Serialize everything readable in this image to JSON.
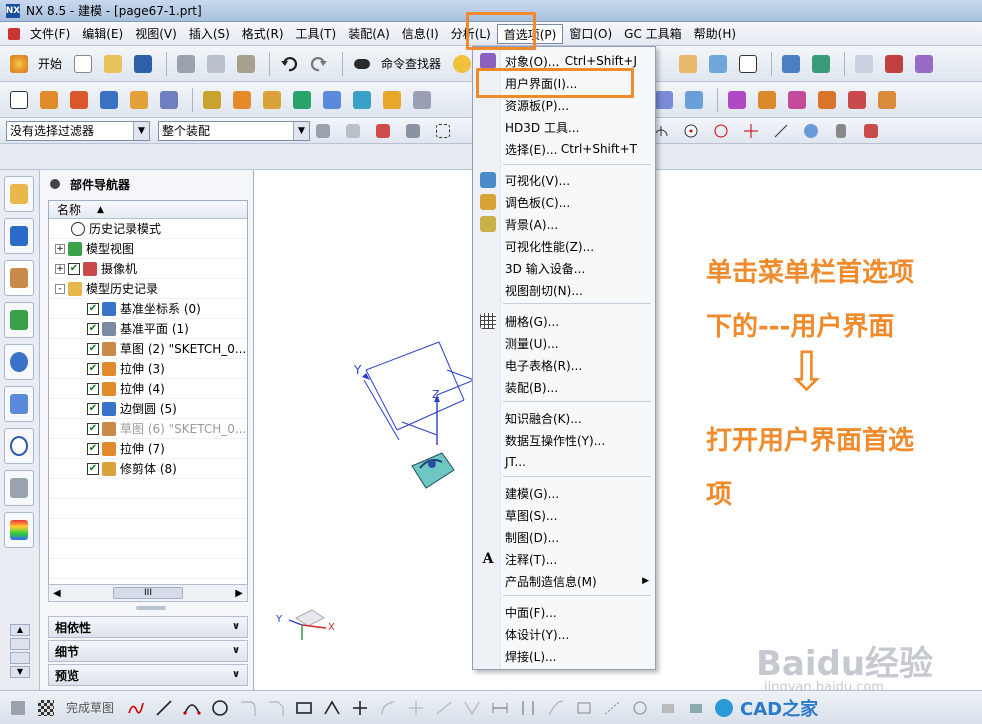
{
  "titlebar": {
    "logo": "NX",
    "title": "NX 8.5 - 建模 - [page67-1.prt]"
  },
  "menubar": {
    "items": [
      "文件(F)",
      "编辑(E)",
      "视图(V)",
      "插入(S)",
      "格式(R)",
      "工具(T)",
      "装配(A)",
      "信息(I)",
      "分析(L)",
      "首选项(P)",
      "窗口(O)",
      "GC 工具箱",
      "帮助(H)"
    ],
    "active_index": 9
  },
  "toolbar": {
    "start_label": "开始",
    "command_finder_label": "命令查找器",
    "filter_select": "没有选择过滤器",
    "scope_select": "整个装配"
  },
  "navigator": {
    "title": "部件导航器",
    "column_header": "名称",
    "rows": [
      {
        "label": "历史记录模式",
        "checked": null,
        "expander": null,
        "dim": false,
        "indent": 1
      },
      {
        "label": "模型视图",
        "checked": null,
        "expander": "+",
        "dim": false,
        "indent": 0
      },
      {
        "label": "摄像机",
        "checked": true,
        "expander": "+",
        "dim": false,
        "indent": 0
      },
      {
        "label": "模型历史记录",
        "checked": null,
        "expander": "-",
        "dim": false,
        "indent": 0
      },
      {
        "label": "基准坐标系 (0)",
        "checked": true,
        "expander": null,
        "dim": false,
        "indent": 2
      },
      {
        "label": "基准平面 (1)",
        "checked": true,
        "expander": null,
        "dim": false,
        "indent": 2
      },
      {
        "label": "草图 (2) \"SKETCH_0...",
        "checked": true,
        "expander": null,
        "dim": false,
        "indent": 2
      },
      {
        "label": "拉伸 (3)",
        "checked": true,
        "expander": null,
        "dim": false,
        "indent": 2
      },
      {
        "label": "拉伸 (4)",
        "checked": true,
        "expander": null,
        "dim": false,
        "indent": 2
      },
      {
        "label": "边倒圆 (5)",
        "checked": true,
        "expander": null,
        "dim": false,
        "indent": 2
      },
      {
        "label": "草图 (6) \"SKETCH_0...",
        "checked": true,
        "expander": null,
        "dim": true,
        "indent": 2
      },
      {
        "label": "拉伸 (7)",
        "checked": true,
        "expander": null,
        "dim": false,
        "indent": 2
      },
      {
        "label": "修剪体 (8)",
        "checked": true,
        "expander": null,
        "dim": false,
        "indent": 2
      }
    ],
    "scroll_thumb": "III",
    "sections": [
      "相依性",
      "细节",
      "预览"
    ]
  },
  "dropdown": {
    "items": [
      {
        "label": "对象(O)...",
        "shortcut": "Ctrl+Shift+J",
        "icon": "brush-icon",
        "color": "#8a5fbf"
      },
      {
        "label": "用户界面(I)...",
        "shortcut": "",
        "icon": "",
        "color": ""
      },
      {
        "label": "资源板(P)...",
        "shortcut": "",
        "icon": "",
        "color": ""
      },
      {
        "label": "HD3D 工具...",
        "shortcut": "",
        "icon": "",
        "color": ""
      },
      {
        "label": "选择(E)...",
        "shortcut": "Ctrl+Shift+T",
        "icon": "",
        "color": ""
      },
      {
        "label": "可视化(V)...",
        "shortcut": "",
        "icon": "visualization-icon",
        "color": "#4a8ac9"
      },
      {
        "label": "调色板(C)...",
        "shortcut": "",
        "icon": "palette-icon",
        "color": "#d9a33a"
      },
      {
        "label": "背景(A)...",
        "shortcut": "",
        "icon": "background-icon",
        "color": "#c8b04a"
      },
      {
        "label": "可视化性能(Z)...",
        "shortcut": "",
        "icon": "",
        "color": ""
      },
      {
        "label": "3D 输入设备...",
        "shortcut": "",
        "icon": "",
        "color": ""
      },
      {
        "label": "视图剖切(N)...",
        "shortcut": "",
        "icon": "",
        "color": ""
      },
      {
        "label": "栅格(G)...",
        "shortcut": "",
        "icon": "grid-icon",
        "color": "#444"
      },
      {
        "label": "测量(U)...",
        "shortcut": "",
        "icon": "",
        "color": ""
      },
      {
        "label": "电子表格(R)...",
        "shortcut": "",
        "icon": "",
        "color": ""
      },
      {
        "label": "装配(B)...",
        "shortcut": "",
        "icon": "",
        "color": ""
      },
      {
        "label": "知识融合(K)...",
        "shortcut": "",
        "icon": "",
        "color": ""
      },
      {
        "label": "数据互操作性(Y)...",
        "shortcut": "",
        "icon": "",
        "color": ""
      },
      {
        "label": "JT...",
        "shortcut": "",
        "icon": "",
        "color": ""
      },
      {
        "label": "建模(G)...",
        "shortcut": "",
        "icon": "",
        "color": ""
      },
      {
        "label": "草图(S)...",
        "shortcut": "",
        "icon": "",
        "color": ""
      },
      {
        "label": "制图(D)...",
        "shortcut": "",
        "icon": "",
        "color": ""
      },
      {
        "label": "注释(T)...",
        "shortcut": "",
        "icon": "annotation-icon",
        "color": "#333"
      },
      {
        "label": "产品制造信息(M)",
        "shortcut": "",
        "icon": "",
        "color": "",
        "submenu": true
      },
      {
        "label": "中面(F)...",
        "shortcut": "",
        "icon": "",
        "color": ""
      },
      {
        "label": "体设计(Y)...",
        "shortcut": "",
        "icon": "",
        "color": ""
      },
      {
        "label": "焊接(L)...",
        "shortcut": "",
        "icon": "",
        "color": ""
      }
    ]
  },
  "statusbar": {
    "finish_sketch_label": "完成草图"
  },
  "annotation": {
    "line1": "单击菜单栏首选项",
    "line2": "下的---用户界面",
    "arrow": "⇩",
    "line3": "打开用户界面首选",
    "line4": "项",
    "color": "#f08a2a"
  },
  "watermark": {
    "baidu": "Baidu经验",
    "url": "jingyan.baidu.com",
    "cad": "CAD之家"
  },
  "viewport": {
    "axis_x": "X",
    "axis_y": "Y",
    "axis_z": "Z"
  }
}
